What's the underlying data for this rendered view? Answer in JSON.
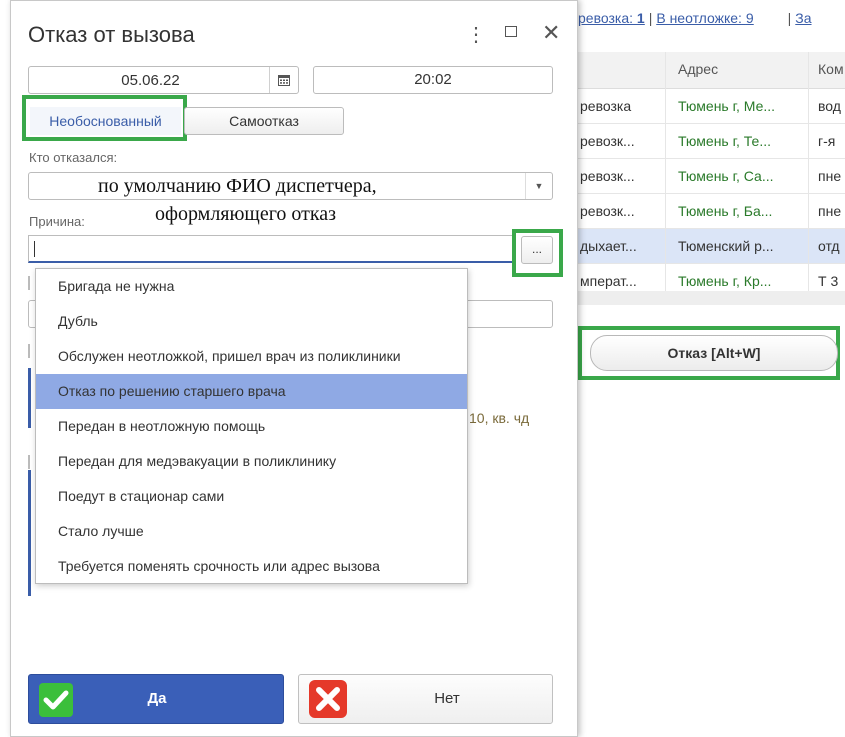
{
  "background": {
    "links": {
      "item1": "ревозка: ",
      "item1_count": "1",
      "item2": "В неотложке: ",
      "item2_count": "9",
      "item3": "За"
    },
    "columns": {
      "col2": "Адрес",
      "col3": "Ком"
    },
    "rows": [
      {
        "c1": "ревозка",
        "c2": "Тюмень г, Ме...",
        "c3": "вод"
      },
      {
        "c1": "ревозк...",
        "c2": "Тюмень г, Те...",
        "c3": "г-я"
      },
      {
        "c1": "ревозк...",
        "c2": "Тюмень г, Са...",
        "c3": "пне"
      },
      {
        "c1": "ревозк...",
        "c2": "Тюмень г, Ба...",
        "c3": "пне"
      },
      {
        "c1": "дыхает...",
        "c2": "Тюменский р...",
        "c3": "отд"
      },
      {
        "c1": "мперат...",
        "c2": "Тюмень г, Кр...",
        "c3": "Т 3"
      }
    ],
    "refuse_button": "Отказ [Alt+W]",
    "partial_text": "10, кв. чд"
  },
  "dialog": {
    "title": "Отказ от вызова",
    "date": "05.06.22",
    "time": "20:02",
    "tabs": {
      "active": "Необоснованный",
      "inactive": "Самоотказ"
    },
    "who_label": "Кто отказался:",
    "who_value": "",
    "annotation_line1": "по умолчанию ФИО диспетчера,",
    "annotation_line2": "оформляющего отказ",
    "reason_label": "Причина:",
    "reason_value": "",
    "dots_label": "...",
    "reasons": [
      "Бригада не нужна",
      "Дубль",
      "Обслужен неотложкой, пришел врач из поликлиники",
      "Отказ по решению старшего врача",
      "Передан в неотложную помощь",
      "Передан для медэвакуации в поликлинику",
      "Поедут в стационар сами",
      "Стало лучше",
      "Требуется поменять срочность или адрес вызова"
    ],
    "highlighted_reason_index": 3,
    "yes_label": "Да",
    "no_label": "Нет"
  }
}
